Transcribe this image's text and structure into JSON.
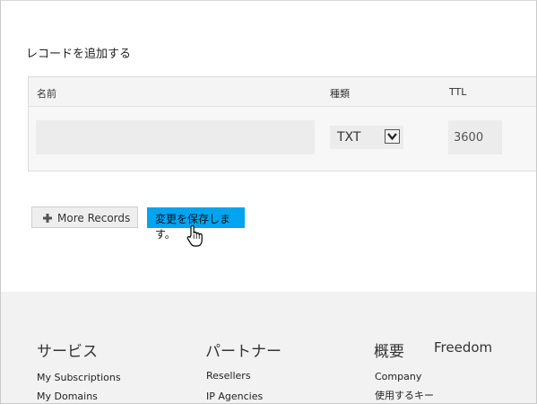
{
  "form": {
    "title": "レコードを追加する",
    "columns": {
      "name": "名前",
      "type": "種類",
      "ttl": "TTL"
    },
    "record": {
      "name_value": "",
      "type_value": "TXT",
      "ttl_value": "3600"
    }
  },
  "buttons": {
    "more_records": "More Records",
    "save": "変更を保存します。"
  },
  "footer": {
    "services": {
      "heading": "サービス",
      "links": [
        "My Subscriptions",
        "My Domains"
      ]
    },
    "partners": {
      "heading": "パートナー",
      "links": [
        "Resellers",
        "IP Agencies"
      ]
    },
    "overview": {
      "heading": "概要",
      "links": [
        "Company",
        "使用するキー"
      ]
    },
    "freedom": {
      "heading": "Freedom"
    }
  },
  "colors": {
    "accent": "#00a4ef",
    "footer_bg": "#f2f2f2"
  },
  "icons": {
    "more": "plus-icon",
    "select": "chevron-down-icon",
    "pointer": "hand-cursor-icon"
  }
}
